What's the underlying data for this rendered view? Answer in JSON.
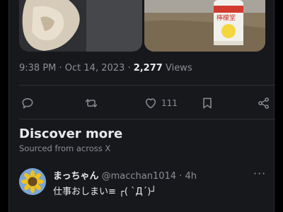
{
  "tweet": {
    "time": "9:38 PM",
    "date": "Oct 14, 2023",
    "views_count": "2,277",
    "views_label": "Views",
    "likes_count": "111"
  },
  "actions": {
    "reply_icon": "reply-icon",
    "retweet_icon": "retweet-icon",
    "like_icon": "heart-icon",
    "bookmark_icon": "bookmark-icon",
    "share_icon": "share-icon"
  },
  "discover": {
    "title": "Discover more",
    "subtitle": "Sourced from across X"
  },
  "post": {
    "author": "まっちゃん",
    "handle": "@macchan1014",
    "separator": "·",
    "time": "4h",
    "text": "仕事おしまい≡ ┌( ˋДˊ)┘",
    "more_icon": "more-icon"
  },
  "colors": {
    "background": "#17181c",
    "muted_text": "#8b8f95",
    "text": "#e7e9ea"
  }
}
